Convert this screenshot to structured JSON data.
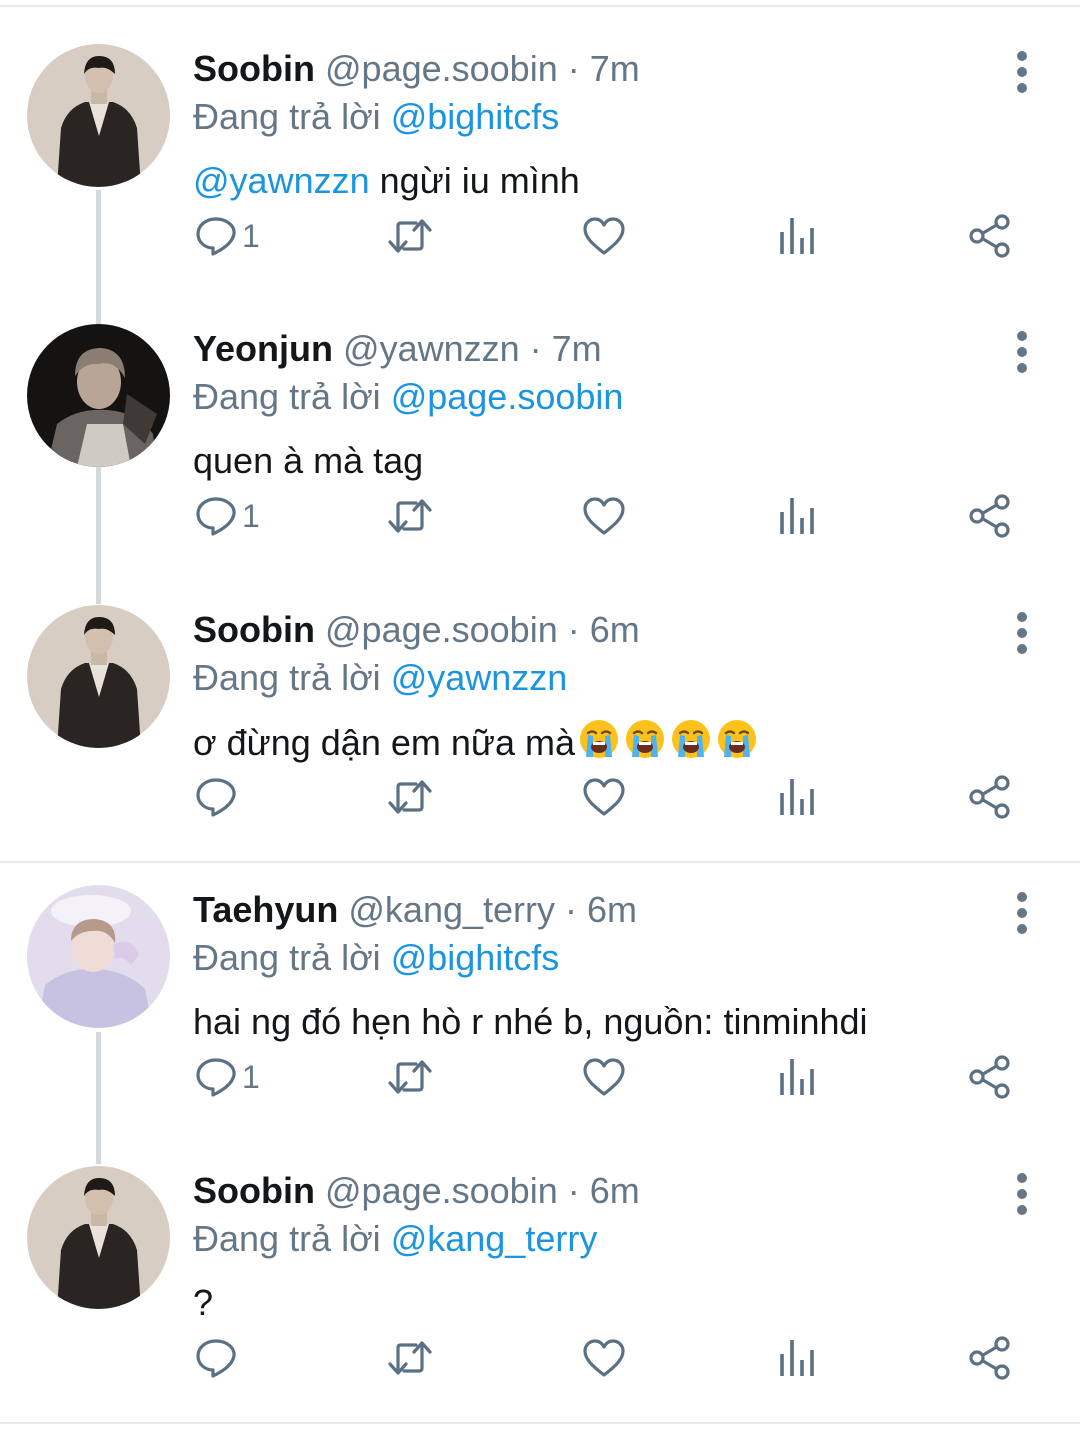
{
  "thread": {
    "tweets": [
      {
        "name": "Soobin",
        "handle": "@page.soobin",
        "separator": " · ",
        "time": "7m",
        "replying_prefix": "Đang trả lời ",
        "replying_to": "@bighitcfs",
        "mention": "@yawnzzn",
        "text": " ngừi iu mình",
        "emoji_count": 0,
        "reply_count": "1",
        "avatar": "soobin-avatar"
      },
      {
        "name": "Yeonjun",
        "handle": "@yawnzzn",
        "separator": " · ",
        "time": "7m",
        "replying_prefix": "Đang trả lời ",
        "replying_to": "@page.soobin",
        "mention": "",
        "text": "quen à mà tag",
        "emoji_count": 0,
        "reply_count": "1",
        "avatar": "yeonjun-avatar"
      },
      {
        "name": "Soobin",
        "handle": "@page.soobin",
        "separator": " · ",
        "time": "6m",
        "replying_prefix": "Đang trả lời ",
        "replying_to": "@yawnzzn",
        "mention": "",
        "text": "ơ đừng dận em nữa mà",
        "emoji_count": 4,
        "reply_count": "",
        "avatar": "soobin-avatar"
      },
      {
        "name": "Taehyun",
        "handle": "@kang_terry",
        "separator": " · ",
        "time": "6m",
        "replying_prefix": "Đang trả lời ",
        "replying_to": "@bighitcfs",
        "mention": "",
        "text": "hai ng đó hẹn hò r nhé b, nguồn: tinminhdi",
        "emoji_count": 0,
        "reply_count": "1",
        "avatar": "taehyun-avatar"
      },
      {
        "name": "Soobin",
        "handle": "@page.soobin",
        "separator": " · ",
        "time": "6m",
        "replying_prefix": "Đang trả lời ",
        "replying_to": "@kang_terry",
        "mention": "",
        "text": "?",
        "emoji_count": 0,
        "reply_count": "",
        "avatar": "soobin-avatar"
      }
    ]
  },
  "icons": {
    "reply": "reply-icon",
    "retweet": "retweet-icon",
    "like": "heart-icon",
    "analytics": "analytics-icon",
    "share": "share-icon",
    "more": "more-vertical-icon",
    "emoji": "loudly-crying-face-emoji"
  },
  "colors": {
    "text": "#14171a",
    "secondary": "#657786",
    "link": "#1b95e0",
    "icon": "#5b7083",
    "divider": "#e8ecef",
    "thread_line": "#d3d8db"
  }
}
